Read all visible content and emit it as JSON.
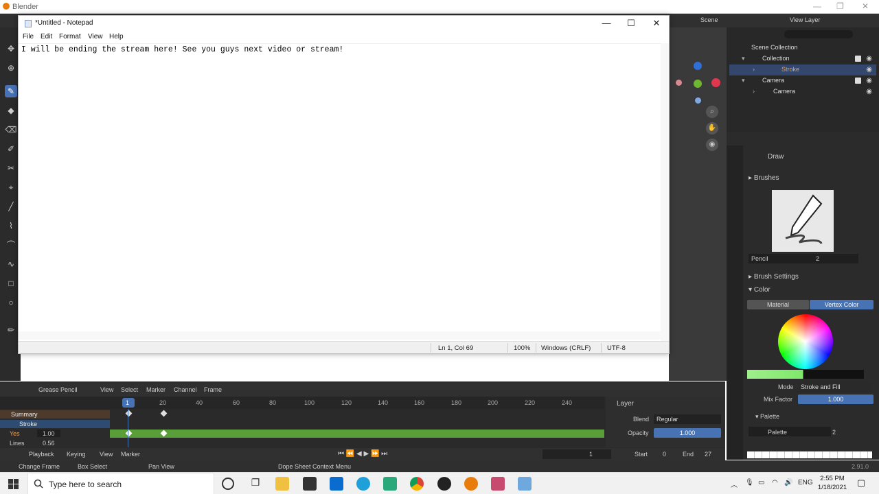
{
  "blender": {
    "window_title": "Blender",
    "scene_label": "Scene",
    "view_layer_label": "View Layer",
    "outliner": {
      "root": "Scene Collection",
      "items": [
        {
          "label": "Collection"
        },
        {
          "label": "Stroke"
        },
        {
          "label": "Camera"
        },
        {
          "label": "Camera"
        }
      ]
    },
    "properties": {
      "tool_name": "Draw",
      "brushes_label": "Brushes",
      "brush_name": "Pencil",
      "brush_users": "2",
      "brush_settings_label": "Brush Settings",
      "color_label": "Color",
      "material_tab": "Material",
      "vertex_color_tab": "Vertex Color",
      "mode_label": "Mode",
      "mode_value": "Stroke and Fill",
      "mix_factor_label": "Mix Factor",
      "mix_factor_value": "1.000",
      "palette_section": "Palette",
      "palette_name": "Palette",
      "palette_users": "2"
    },
    "dopesheet": {
      "editor_mode": "Grease Pencil",
      "menus": [
        "View",
        "Select",
        "Marker",
        "Channel",
        "Frame"
      ],
      "ruler_ticks": [
        "1",
        "20",
        "40",
        "60",
        "80",
        "100",
        "120",
        "140",
        "160",
        "180",
        "200",
        "220",
        "240"
      ],
      "channels": [
        {
          "label": "Summary"
        },
        {
          "label": "Stroke"
        },
        {
          "label": "Yes",
          "value": "1.00"
        },
        {
          "label": "Lines",
          "value": "0.56"
        }
      ],
      "layer_panel": {
        "title": "Layer",
        "blend_label": "Blend",
        "blend_value": "Regular",
        "opacity_label": "Opacity",
        "opacity_value": "1.000"
      }
    },
    "playback": {
      "menus": [
        "Playback",
        "Keying",
        "View",
        "Marker"
      ],
      "current_frame": "1",
      "start_label": "Start",
      "start_value": "0",
      "end_label": "End",
      "end_value": "27"
    },
    "statusbar": {
      "items": [
        "Change Frame",
        "Box Select",
        "Pan View",
        "Dope Sheet Context Menu"
      ],
      "version": "2.91.0"
    }
  },
  "notepad": {
    "title": "*Untitled - Notepad",
    "menu": [
      "File",
      "Edit",
      "Format",
      "View",
      "Help"
    ],
    "content": "I will be ending the stream here! See you guys next video or stream!",
    "status": {
      "position": "Ln 1, Col 69",
      "zoom": "100%",
      "line_ending": "Windows (CRLF)",
      "encoding": "UTF-8"
    }
  },
  "taskbar": {
    "search_placeholder": "Type here to search",
    "language": "ENG",
    "time": "2:55 PM",
    "date": "1/18/2021",
    "apps": [
      "cortana-icon",
      "task-view-icon",
      "file-explorer-icon",
      "store-icon",
      "mail-icon",
      "edge-icon",
      "app-icon",
      "chrome-icon",
      "obs-icon",
      "blender-icon",
      "app-icon",
      "notepad-icon"
    ]
  },
  "colors": {
    "accent_blue": "#4772b3",
    "keyframe_green": "#5a9e3a",
    "blender_dark": "#2b2b2b"
  }
}
